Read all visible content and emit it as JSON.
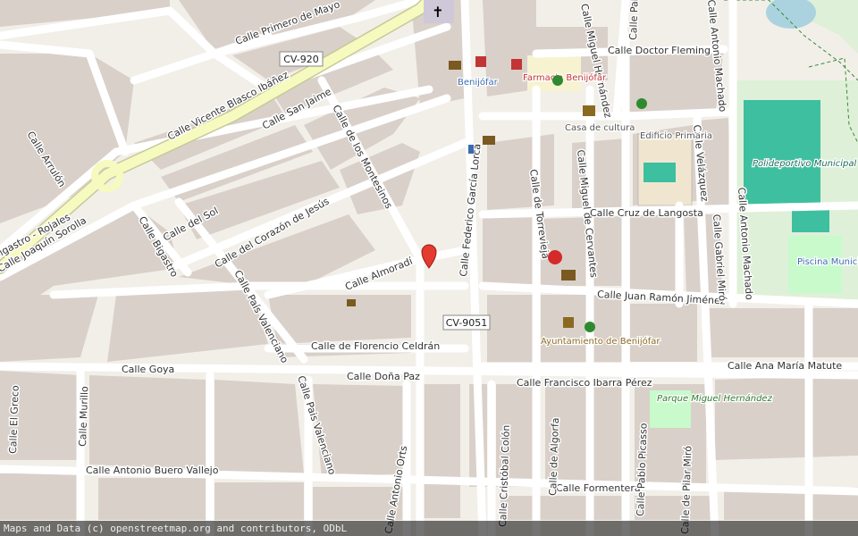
{
  "map": {
    "attribution": "Maps and Data (c) openstreetmap.org and contributors, ODbL",
    "colors": {
      "background": "#f2efe9",
      "block": "#d9d0c9",
      "road": "#ffffff",
      "primary_road": "#f7fabf",
      "primary_casing": "#c6c99a",
      "sports": "#dff0d8",
      "pitch": "#3ebfa0",
      "park": "#c8facc",
      "water": "#aad3df",
      "marker": "#e53a2f",
      "pharmacy": "#d42a2a",
      "route_shield": "#ffffff"
    },
    "streets": [
      "Calle Primero de Mayo",
      "Calle Vicente Blasco Ibáñez",
      "Calle San Jaime",
      "Calle Arrulón",
      "Bigastro - Rojales",
      "Calle Joaquín Sorolla",
      "Calle Bigastro",
      "Calle del Sol",
      "Calle del Corazón de Jesús",
      "Calle de los Montesinos",
      "Calle Almoradí",
      "Calle País Valenciano",
      "Calle de Florencio Celdrán",
      "Calle Goya",
      "Calle Doña Paz",
      "Calle Francisco Ibarra Pérez",
      "Calle Antonio Buero Vallejo",
      "Calle Formentera",
      "Calle Federico García Lorca",
      "Calle de Torrevieja",
      "Calle Miguel de Cervantes",
      "Calle Cruz de Langosta",
      "Calle Juan Ramón Jiménez",
      "Calle Ana María Matute",
      "Calle Doctor Fleming",
      "Calle Miguel Hernández",
      "Calle Pablo Picasso",
      "Calle Velázquez",
      "Calle Gabriel Miró",
      "Calle Antonio Machado",
      "Calle El Greco",
      "Calle Murillo",
      "Calle Cristóbal Colón",
      "Calle de Algorfa",
      "Calle Antonio Orts",
      "Calle de Pilar Miró",
      "Calle Pais Valenciano"
    ],
    "routes": [
      "CV-920",
      "CV-9051"
    ],
    "pois": [
      "Benijófar",
      "Farmacia Benijófar",
      "Casa de cultura",
      "Edificio Primaria",
      "Polideportivo Municipal",
      "Piscina Municipal",
      "Ayuntamiento de Benijófar",
      "Parque Miguel Hernández"
    ]
  }
}
